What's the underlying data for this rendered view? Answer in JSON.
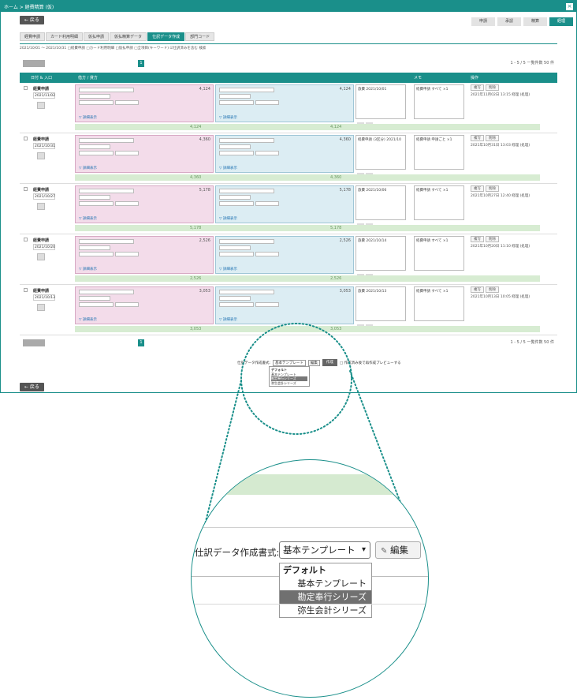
{
  "topbar": {
    "breadcrumb": "ホーム > 経費精算 (仮)",
    "close": "×"
  },
  "back_button": "← 戻る",
  "top_nav": [
    {
      "label": "申請",
      "active": false
    },
    {
      "label": "承認",
      "active": false
    },
    {
      "label": "精算",
      "active": false
    },
    {
      "label": "経理",
      "active": true
    }
  ],
  "tabs": [
    {
      "label": "経費申請",
      "active": false
    },
    {
      "label": "カード利用明細",
      "active": false
    },
    {
      "label": "仮払申請",
      "active": false
    },
    {
      "label": "仮払精算データ",
      "active": false
    },
    {
      "label": "仕訳データ作成",
      "active": true
    },
    {
      "label": "部門コード",
      "active": false
    }
  ],
  "filter_text": "2021/10/01 〜 2021/10/31  □経費申請 □カード利用明細 □仮払申請 □全項目(キーワード)   ☑仕訳済みを含む  検索",
  "pager": {
    "current": "1",
    "info": "1 - 5 / 5  一覧件数 50 件"
  },
  "table_header": {
    "date_col": "日付 & 入口",
    "detail_col": "借方 / 貸方",
    "memo_col": "メモ",
    "ops_col": "操作"
  },
  "entries": [
    {
      "type": "経費申請",
      "date": "2021/11/02",
      "amount": "4,124",
      "memo": "旅費 2021/10/01",
      "tag": "経費申請 すべて ×1",
      "log": "2021年11月02日 13:15 経理 (処理)"
    },
    {
      "type": "経費申請",
      "date": "2021/10/31",
      "amount": "4,360",
      "memo": "経費申請 (3区分) 2021/10",
      "tag": "経費申請 申請ごと ×1",
      "log": "2021年10月31日 13:03 経理 (処理)"
    },
    {
      "type": "経費申請",
      "date": "2021/10/27",
      "amount": "5,178",
      "memo": "旅費 2021/10/06",
      "tag": "経費申請 すべて ×1",
      "log": "2021年10月27日 12:40 経理 (処理)"
    },
    {
      "type": "経費申請",
      "date": "2021/10/20",
      "amount": "2,526",
      "memo": "旅費 2021/10/14",
      "tag": "経費申請 すべて ×1",
      "log": "2021年10月20日 11:10 経理 (処理)"
    },
    {
      "type": "経費申請",
      "date": "2021/10/13",
      "amount": "3,053",
      "memo": "旅費 2021/10/13",
      "tag": "経費申請 すべて ×1",
      "log": "2021年10月13日 10:05 経理 (処理)"
    }
  ],
  "entry_link": "▽ 詳細表示",
  "entry_ops": {
    "copy": "複写",
    "delete": "削除"
  },
  "template_row": {
    "label": "仕訳データ作成書式:",
    "selected": "基本テンプレート",
    "edit": "編集",
    "create": "作成",
    "option_text": "□ 作成済み後で再作成プレビューする"
  },
  "dropdown": {
    "group": "デフォルト",
    "options": [
      "基本テンプレート",
      "勘定奉行シリーズ",
      "弥生会計シリーズ"
    ],
    "highlighted": "勘定奉行シリーズ"
  },
  "footer_button": "← 戻る",
  "colors": {
    "accent": "#1a8f8a",
    "debit": "#f3dcea",
    "credit": "#dcedf3",
    "total": "#d7ecd2"
  }
}
